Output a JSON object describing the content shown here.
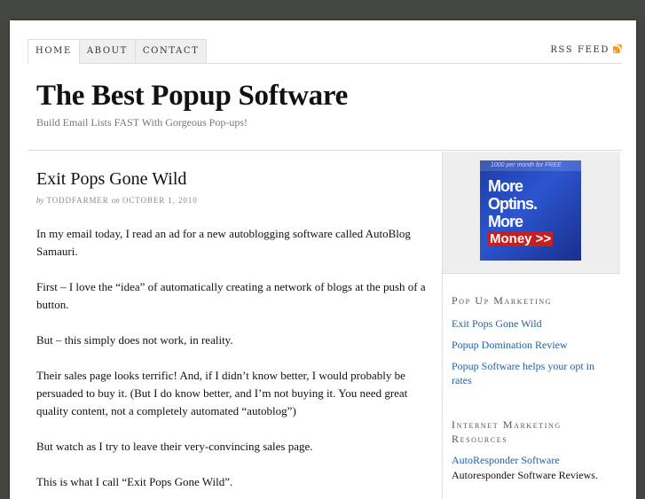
{
  "nav": {
    "tabs": [
      {
        "label": "Home",
        "active": true
      },
      {
        "label": "About",
        "active": false
      },
      {
        "label": "Contact",
        "active": false
      }
    ],
    "rss_label": "RSS Feed"
  },
  "header": {
    "title": "The Best Popup Software",
    "tagline": "Build Email Lists FAST With Gorgeous Pop-ups!"
  },
  "post": {
    "title": "Exit Pops Gone Wild",
    "by_word": "by",
    "author": "toddfarmer",
    "on_word": "on",
    "date": "October 1, 2010",
    "paragraphs": [
      "In my email today, I read an ad for a new autoblogging software called AutoBlog Samauri.",
      "First – I love the “idea” of automatically creating a network of blogs at the push of a button.",
      "But – this simply does not work, in reality.",
      "Their sales page looks terrific! And, if I didn’t know better, I would probably be persuaded to buy it. (But I do know better, and I’m not buying it. You need great quality content, not a completely automated “autoblog”)",
      "But watch as I try to leave their very-convincing sales page.",
      "This is  what I call  “Exit Pops Gone Wild”."
    ]
  },
  "sidebar": {
    "ad": {
      "strip_text": "1000 per month for FREE",
      "line1": "More",
      "line2": "Optins.",
      "line3": "More",
      "money": "Money >>",
      "colors": {
        "background": "#2348bf",
        "money_bg": "#c81e1e"
      }
    },
    "widget1": {
      "title": "Pop Up Marketing",
      "links": [
        "Exit Pops Gone Wild",
        "Popup Domination Review",
        "Popup Software helps your opt in rates"
      ]
    },
    "widget2": {
      "title": "Internet Marketing Resources",
      "link": "AutoResponder Software",
      "description": "Autoresponder Software Reviews."
    }
  },
  "colors": {
    "page_bg": "#444641",
    "link": "#2361a1",
    "sidebar_box": "#eeeeee"
  }
}
